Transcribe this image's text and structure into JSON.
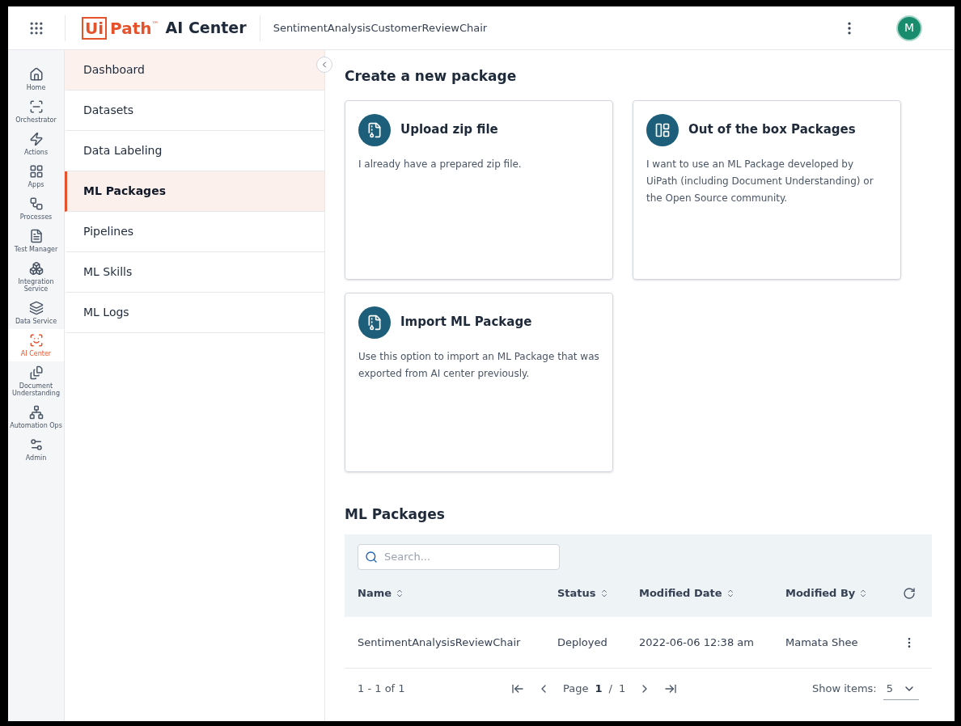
{
  "header": {
    "logo": {
      "boxed": "Ui",
      "rest": "Path",
      "mark": "™"
    },
    "product": "AI Center",
    "project": "SentimentAnalysisCustomerReviewChair",
    "avatar": "M"
  },
  "rail": [
    {
      "kind": "home",
      "label": "Home",
      "selected": false
    },
    {
      "kind": "orchestrator",
      "label": "Orchestrator",
      "selected": false
    },
    {
      "kind": "actions",
      "label": "Actions",
      "selected": false
    },
    {
      "kind": "apps",
      "label": "Apps",
      "selected": false
    },
    {
      "kind": "processes",
      "label": "Processes",
      "selected": false
    },
    {
      "kind": "test",
      "label": "Test Manager",
      "selected": false
    },
    {
      "kind": "integration",
      "label": "Integration Service",
      "selected": false
    },
    {
      "kind": "data",
      "label": "Data Service",
      "selected": false
    },
    {
      "kind": "ai",
      "label": "AI Center",
      "selected": true
    },
    {
      "kind": "document",
      "label": "Document Understanding",
      "selected": false
    },
    {
      "kind": "ops",
      "label": "Automation Ops",
      "selected": false
    },
    {
      "kind": "admin",
      "label": "Admin",
      "selected": false
    }
  ],
  "subnav": [
    {
      "label": "Dashboard",
      "selected": false,
      "hovered": true
    },
    {
      "label": "Datasets",
      "selected": false,
      "hovered": false
    },
    {
      "label": "Data Labeling",
      "selected": false,
      "hovered": false
    },
    {
      "label": "ML Packages",
      "selected": true,
      "hovered": false
    },
    {
      "label": "Pipelines",
      "selected": false,
      "hovered": false
    },
    {
      "label": "ML Skills",
      "selected": false,
      "hovered": false
    },
    {
      "label": "ML Logs",
      "selected": false,
      "hovered": false
    }
  ],
  "create": {
    "title": "Create a new package",
    "cards": [
      {
        "kind": "upload",
        "title": "Upload zip file",
        "description": "I already have a prepared zip file."
      },
      {
        "kind": "box",
        "title": "Out of the box Packages",
        "description": "I want to use an ML Package developed by UiPath (including Document Understanding) or the Open Source community."
      },
      {
        "kind": "upload",
        "title": "Import ML Package",
        "description": "Use this option to import an ML Package that was exported from AI center previously."
      }
    ]
  },
  "packages": {
    "title": "ML Packages",
    "search": {
      "placeholder": "Search..."
    },
    "columns": [
      "Name",
      "Status",
      "Modified Date",
      "Modified By"
    ],
    "rows": [
      {
        "name": "SentimentAnalysisReviewChair",
        "status": "Deployed",
        "modified_date": "2022-06-06 12:38 am",
        "modified_by": "Mamata Shee"
      }
    ],
    "pagination": {
      "range": "1 - 1 of 1",
      "page_label": "Page",
      "page": "1",
      "separator": "/",
      "pages": "1",
      "show_items_label": "Show items:",
      "show_items": "5"
    }
  }
}
